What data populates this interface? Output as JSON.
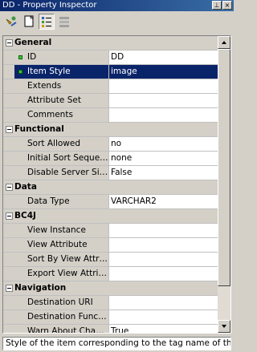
{
  "window": {
    "title": "DD - Property Inspector",
    "pin_glyph": "⊥",
    "close_glyph": "×"
  },
  "toolbar": {
    "buttons": [
      {
        "icon": "connect-icon"
      },
      {
        "icon": "new-window-icon"
      },
      {
        "icon": "categorized-view-icon",
        "pressed": true
      },
      {
        "icon": "alphabetical-view-icon"
      }
    ]
  },
  "grid": {
    "rows": [
      {
        "type": "category",
        "label": "General"
      },
      {
        "type": "prop",
        "name": "ID",
        "value": "DD",
        "marker": true
      },
      {
        "type": "prop",
        "name": "Item Style",
        "value": "image",
        "marker": true,
        "selected": true
      },
      {
        "type": "prop",
        "name": "Extends",
        "value": ""
      },
      {
        "type": "prop",
        "name": "Attribute Set",
        "value": ""
      },
      {
        "type": "prop",
        "name": "Comments",
        "value": ""
      },
      {
        "type": "category",
        "label": "Functional"
      },
      {
        "type": "prop",
        "name": "Sort Allowed",
        "value": "no"
      },
      {
        "type": "prop",
        "name": "Initial Sort Sequence",
        "value": "none"
      },
      {
        "type": "prop",
        "name": "Disable Server Sid...",
        "value": "False"
      },
      {
        "type": "category",
        "label": "Data"
      },
      {
        "type": "prop",
        "name": "Data Type",
        "value": "VARCHAR2"
      },
      {
        "type": "category",
        "label": "BC4J"
      },
      {
        "type": "prop",
        "name": "View Instance",
        "value": ""
      },
      {
        "type": "prop",
        "name": "View Attribute",
        "value": ""
      },
      {
        "type": "prop",
        "name": "Sort By View Attri...",
        "value": ""
      },
      {
        "type": "prop",
        "name": "Export View Attrib...",
        "value": ""
      },
      {
        "type": "category",
        "label": "Navigation"
      },
      {
        "type": "prop",
        "name": "Destination URI",
        "value": ""
      },
      {
        "type": "prop",
        "name": "Destination Function",
        "value": ""
      },
      {
        "type": "prop",
        "name": "Warn About Chang...",
        "value": "True"
      }
    ]
  },
  "status": {
    "text": "Style of the item corresponding to the tag name of the"
  },
  "colors": {
    "selection": "#0a246a",
    "face": "#d4d0c8",
    "marker": "#3fc83f"
  }
}
